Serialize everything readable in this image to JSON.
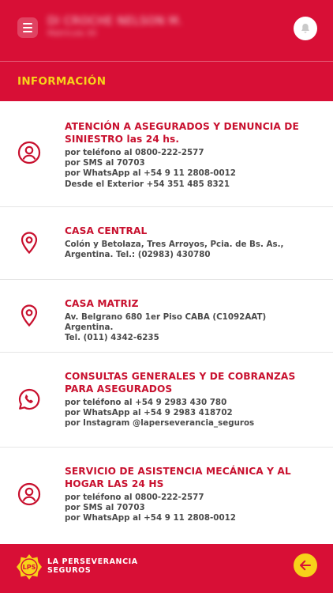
{
  "header": {
    "user_name": "DI CROCHE NELSON M.",
    "user_sub": "Matrícula 30",
    "menu_icon": "hamburger-menu-icon",
    "bell_icon": "bell-icon",
    "section_title": "INFORMACIÓN"
  },
  "items": [
    {
      "icon": "user-circle-icon",
      "title_lines": [
        "ATENCIÓN A ASEGURADOS Y DENUNCIA DE",
        "SINIESTRO las 24 hs."
      ],
      "lines": [
        "por teléfono al 0800-222-2577",
        "por SMS al 70703",
        "por WhatsApp al +54 9 11 2808-0012",
        "Desde el Exterior +54 351 485 8321"
      ]
    },
    {
      "icon": "location-pin-icon",
      "title_lines": [
        "CASA CENTRAL"
      ],
      "lines": [
        "Colón y Betolaza, Tres Arroyos, Pcia. de Bs. As.,",
        "Argentina. Tel.: (02983) 430780"
      ]
    },
    {
      "icon": "location-pin-icon",
      "title_lines": [
        "CASA MATRIZ"
      ],
      "lines": [
        "Av. Belgrano 680 1er Piso CABA (C1092AAT) Argentina.",
        "Tel. (011) 4342-6235"
      ]
    },
    {
      "icon": "whatsapp-icon",
      "title_lines": [
        "CONSULTAS GENERALES Y DE COBRANZAS",
        "PARA ASEGURADOS"
      ],
      "lines": [
        "por teléfono al +54 9 2983 430 780",
        "por WhatsApp al +54 9 2983 418702",
        "por Instagram @laperseverancia_seguros"
      ]
    },
    {
      "icon": "user-circle-icon",
      "title_lines": [
        "SERVICIO DE ASISTENCIA MECÁNICA Y AL",
        "HOGAR LAS 24 HS"
      ],
      "lines": [
        "por teléfono al 0800-222-2577",
        "por SMS al 70703",
        "por WhatsApp al +54 9 11 2808-0012"
      ]
    }
  ],
  "footer": {
    "logo_text": "LPS",
    "brand_line1": "LA PERSEVERANCIA",
    "brand_line2": "SEGUROS",
    "back_icon": "arrow-left-icon"
  },
  "colors": {
    "primary_red": "#d80f36",
    "title_red": "#c8102e",
    "accent_yellow": "#f7d21a",
    "body_text": "#4a4a4a"
  }
}
